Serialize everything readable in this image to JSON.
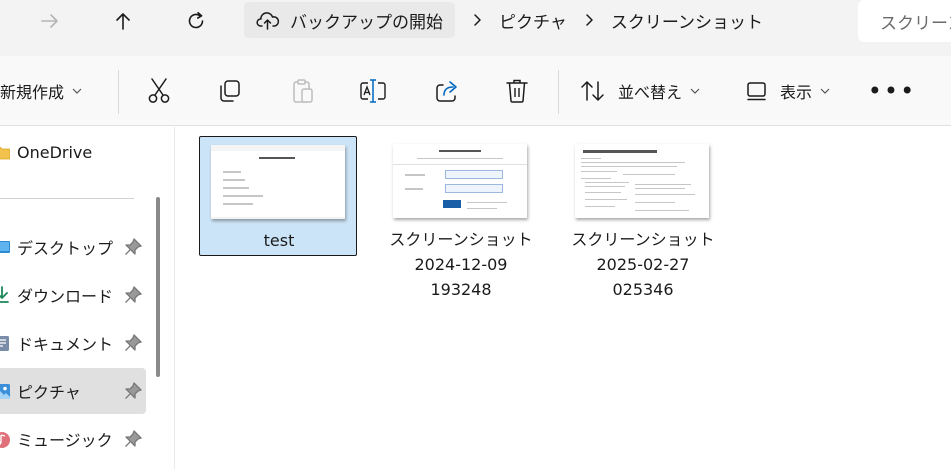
{
  "address_bar": {
    "breadcrumb": [
      "バックアップの開始",
      "ピクチャ",
      "スクリーンショット"
    ],
    "search_placeholder": "スクリーンショット"
  },
  "command_bar": {
    "new_label": "新規作成",
    "sort_label": "並べ替え",
    "view_label": "表示"
  },
  "nav_pane": {
    "items": [
      {
        "label": "OneDrive",
        "icon": "folder-icon",
        "pinned": false
      },
      {
        "label": "デスクトップ",
        "icon": "desktop-icon",
        "pinned": true
      },
      {
        "label": "ダウンロード",
        "icon": "download-icon",
        "pinned": true
      },
      {
        "label": "ドキュメント",
        "icon": "document-icon",
        "pinned": true
      },
      {
        "label": "ピクチャ",
        "icon": "pictures-icon",
        "pinned": true,
        "selected": true
      },
      {
        "label": "ミュージック",
        "icon": "music-icon",
        "pinned": true
      }
    ]
  },
  "files": [
    {
      "name_lines": [
        "test"
      ],
      "selected": true
    },
    {
      "name_lines": [
        "スクリーンショット",
        "2024-12-09",
        "193248"
      ],
      "selected": false
    },
    {
      "name_lines": [
        "スクリーンショット",
        "2025-02-27",
        "025346"
      ],
      "selected": false
    }
  ],
  "colors": {
    "selection": "#cce4f7",
    "accent_blue": "#0067c0"
  }
}
